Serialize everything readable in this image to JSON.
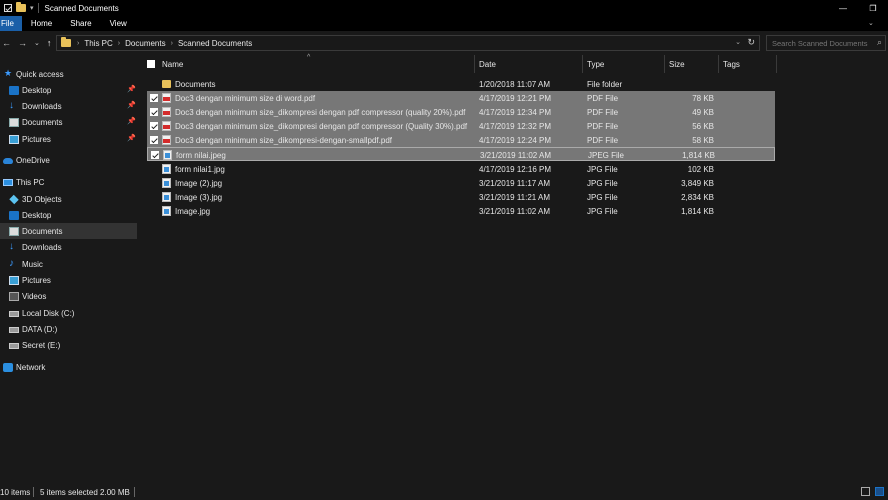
{
  "window": {
    "title": "Scanned Documents",
    "minimize": "—",
    "maximize": "❐"
  },
  "ribbon": {
    "tabs": [
      "File",
      "Home",
      "Share",
      "View"
    ]
  },
  "address": {
    "crumbs": [
      "This PC",
      "Documents",
      "Scanned Documents"
    ],
    "search_placeholder": "Search Scanned Documents"
  },
  "sidebar": {
    "items": [
      {
        "label": "Quick access",
        "icon": "star-icon",
        "pinned": false
      },
      {
        "label": "Desktop",
        "icon": "desktop-icon",
        "pinned": true
      },
      {
        "label": "Downloads",
        "icon": "download-icon",
        "pinned": true
      },
      {
        "label": "Documents",
        "icon": "documents-icon",
        "pinned": true
      },
      {
        "label": "Pictures",
        "icon": "pictures-icon",
        "pinned": true
      },
      {
        "label": "OneDrive",
        "icon": "cloud-icon",
        "pinned": false
      },
      {
        "label": "This PC",
        "icon": "computer-icon",
        "pinned": false
      },
      {
        "label": "3D Objects",
        "icon": "3d-objects-icon",
        "pinned": false
      },
      {
        "label": "Desktop",
        "icon": "desktop-icon",
        "pinned": false
      },
      {
        "label": "Documents",
        "icon": "documents-icon",
        "pinned": false,
        "selected": true
      },
      {
        "label": "Downloads",
        "icon": "download-icon",
        "pinned": false
      },
      {
        "label": "Music",
        "icon": "music-icon",
        "pinned": false
      },
      {
        "label": "Pictures",
        "icon": "pictures-icon",
        "pinned": false
      },
      {
        "label": "Videos",
        "icon": "videos-icon",
        "pinned": false
      },
      {
        "label": "Local Disk (C:)",
        "icon": "disk-icon",
        "pinned": false
      },
      {
        "label": "DATA (D:)",
        "icon": "disk-icon",
        "pinned": false
      },
      {
        "label": "Secret (E:)",
        "icon": "disk-icon",
        "pinned": false
      },
      {
        "label": "Network",
        "icon": "network-icon",
        "pinned": false
      }
    ]
  },
  "columns": {
    "name": "Name",
    "date": "Date",
    "type": "Type",
    "size": "Size",
    "tags": "Tags"
  },
  "files": [
    {
      "name": "Documents",
      "date": "1/20/2018 11:07 AM",
      "type": "File folder",
      "size": "",
      "kind": "folder",
      "selected": false
    },
    {
      "name": "Doc3 dengan minimum size di word.pdf",
      "date": "4/17/2019 12:21 PM",
      "type": "PDF File",
      "size": "78 KB",
      "kind": "pdf",
      "selected": true
    },
    {
      "name": "Doc3 dengan minimum size_dikompresi dengan pdf compressor (quality 20%).pdf",
      "date": "4/17/2019 12:34 PM",
      "type": "PDF File",
      "size": "49 KB",
      "kind": "pdf",
      "selected": true
    },
    {
      "name": "Doc3 dengan minimum size_dikompresi dengan pdf compressor (Quality 30%).pdf",
      "date": "4/17/2019 12:32 PM",
      "type": "PDF File",
      "size": "56 KB",
      "kind": "pdf",
      "selected": true
    },
    {
      "name": "Doc3 dengan minimum size_dikompresi-dengan-smallpdf.pdf",
      "date": "4/17/2019 12:24 PM",
      "type": "PDF File",
      "size": "58 KB",
      "kind": "pdf",
      "selected": true
    },
    {
      "name": "form nilai.jpeg",
      "date": "3/21/2019 11:02 AM",
      "type": "JPEG File",
      "size": "1,814 KB",
      "kind": "img",
      "selected": true
    },
    {
      "name": "form nilai1.jpg",
      "date": "4/17/2019 12:16 PM",
      "type": "JPG File",
      "size": "102 KB",
      "kind": "img",
      "selected": false
    },
    {
      "name": "Image (2).jpg",
      "date": "3/21/2019 11:17 AM",
      "type": "JPG File",
      "size": "3,849 KB",
      "kind": "img",
      "selected": false
    },
    {
      "name": "Image (3).jpg",
      "date": "3/21/2019 11:21 AM",
      "type": "JPG File",
      "size": "2,834 KB",
      "kind": "img",
      "selected": false
    },
    {
      "name": "Image.jpg",
      "date": "3/21/2019 11:02 AM",
      "type": "JPG File",
      "size": "1,814 KB",
      "kind": "img",
      "selected": false
    }
  ],
  "status": {
    "item_count": "10 items",
    "selection": "5 items selected  2.00 MB"
  }
}
